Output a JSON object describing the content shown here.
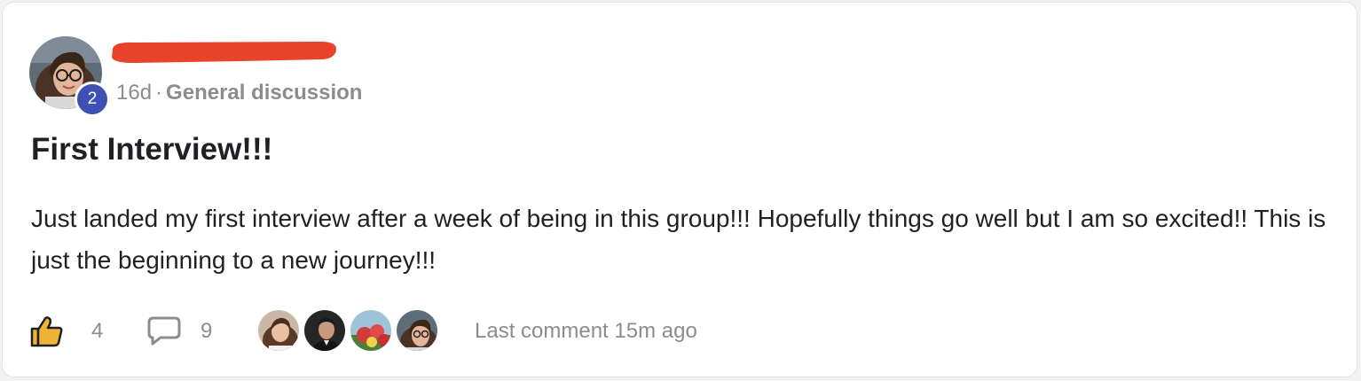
{
  "post": {
    "author_level": "2",
    "time_ago": "16d",
    "separator": "·",
    "category": "General discussion",
    "title": "First Interview!!!",
    "body": "Just landed my first interview after a week of being in this group!!! Hopefully things go well but I am so excited!! This is just the beginning to a new journey!!!"
  },
  "footer": {
    "like_count": "4",
    "comment_count": "9",
    "last_comment": "Last comment 15m ago"
  },
  "colors": {
    "level_badge": "#3f51b5",
    "redaction": "#e8432b",
    "like_icon": "#f0b33a",
    "muted_text": "#8c8c8c"
  },
  "icons": {
    "like": "thumbs-up-icon",
    "comment": "speech-bubble-icon"
  }
}
